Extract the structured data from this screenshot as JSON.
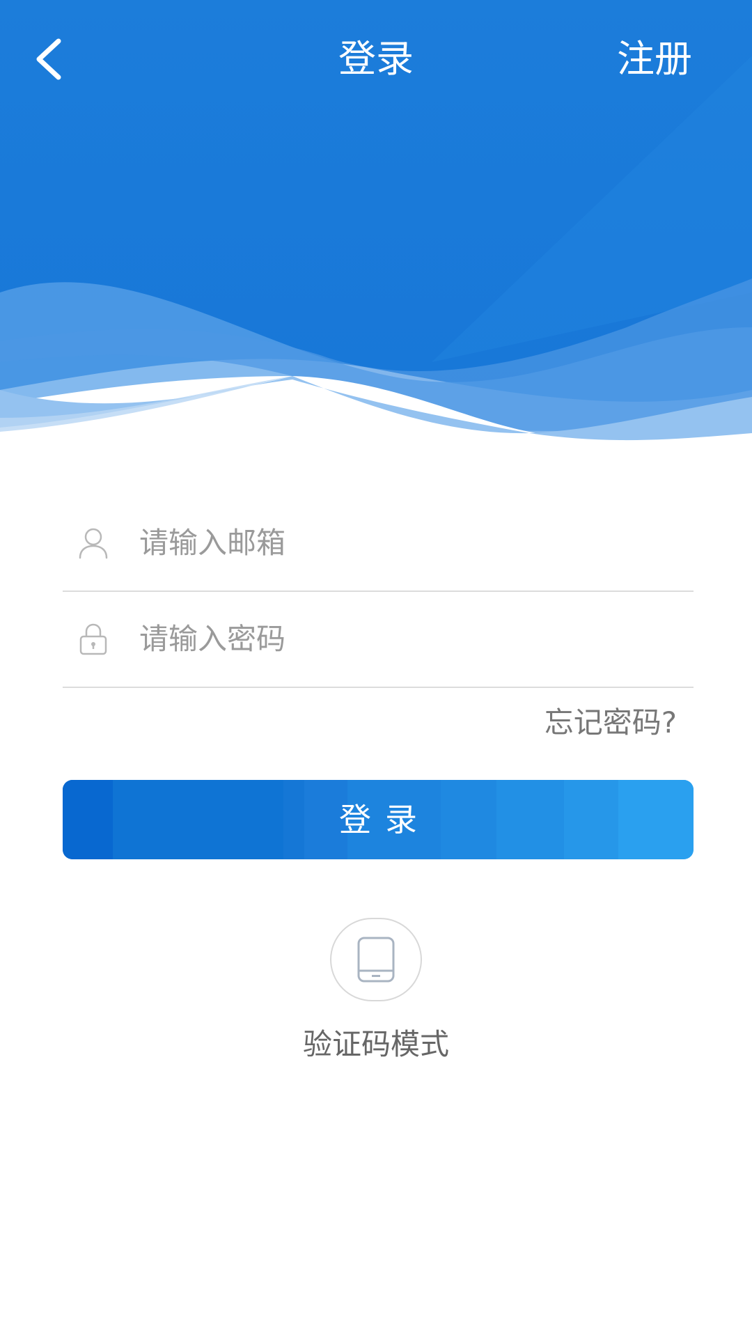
{
  "colors": {
    "brand_blue": "#1a7ad8",
    "wave_light": "#94c2f0",
    "text_gray": "#9a9a9a",
    "divider": "#dcdcdc"
  },
  "header": {
    "back_icon": "chevron-left-icon",
    "title": "登录",
    "register_label": "注册"
  },
  "form": {
    "email": {
      "icon": "user-icon",
      "placeholder": "请输入邮箱"
    },
    "password": {
      "icon": "lock-icon",
      "placeholder": "请输入密码"
    },
    "forgot_label": "忘记密码?",
    "submit_label": "登录"
  },
  "alt_login": {
    "icon": "tablet-icon",
    "label": "验证码模式"
  }
}
